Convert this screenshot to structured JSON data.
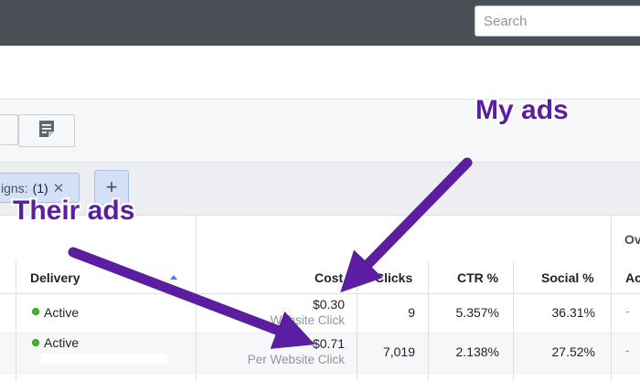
{
  "search": {
    "placeholder": "Search"
  },
  "filters": {
    "chip_label": "igns:",
    "chip_count": "(1)",
    "chip_remove": "✕",
    "add_label": "+"
  },
  "table": {
    "group_header": "Ov",
    "columns": {
      "delivery": "Delivery",
      "cost": "Cost",
      "clicks": "Clicks",
      "ctr": "CTR %",
      "social": "Social %",
      "ac": "Ac"
    },
    "rows": [
      {
        "delivery": "Active",
        "cost": "$0.30",
        "cost_sub": "Website Click",
        "clicks": "9",
        "ctr": "5.357%",
        "social": "36.31%",
        "ac": "-"
      },
      {
        "delivery": "Active",
        "cost": "$0.71",
        "cost_sub": "Per Website Click",
        "clicks": "7,019",
        "ctr": "2.138%",
        "social": "27.52%",
        "ac": "-"
      }
    ]
  },
  "annotations": {
    "my_ads": "My ads",
    "their_ads": "Their ads"
  },
  "colors": {
    "annotation": "#5b1ea0",
    "active_status": "#42b72a",
    "topbar": "#4b4f56"
  }
}
